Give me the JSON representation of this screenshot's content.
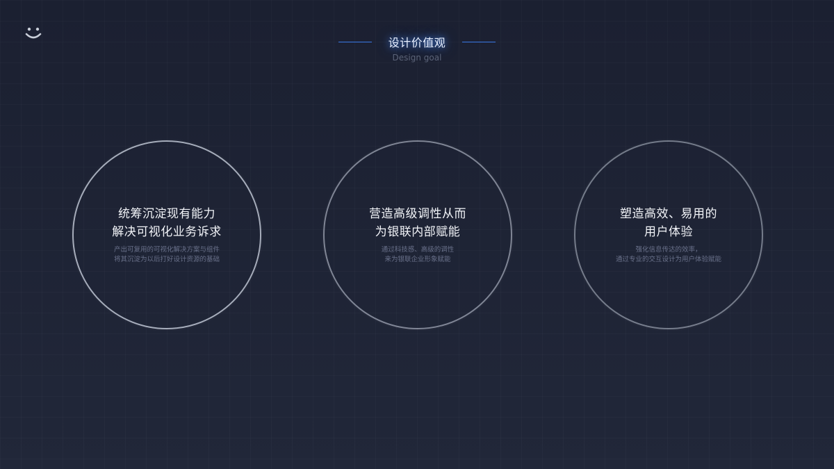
{
  "logo": {
    "icon": "smile-icon"
  },
  "header": {
    "title": "设计价值观",
    "subtitle": "Design goal",
    "accent_color": "#3a7be8"
  },
  "goals": [
    {
      "heading_lines": [
        "统筹沉淀现有能力",
        "解决可视化业务诉求"
      ],
      "desc_lines": [
        "产出可复用的可视化解决方案与组件",
        "将其沉淀为以后打好设计资源的基础"
      ]
    },
    {
      "heading_lines": [
        "营造高级调性从而",
        "为银联内部赋能"
      ],
      "desc_lines": [
        "通过科技感、高级的调性",
        "来为银联企业形象赋能"
      ]
    },
    {
      "heading_lines": [
        "塑造高效、易用的",
        "用户体验"
      ],
      "desc_lines": [
        "强化信息传达的效率，",
        "通过专业的交互设计为用户体验赋能"
      ]
    }
  ]
}
